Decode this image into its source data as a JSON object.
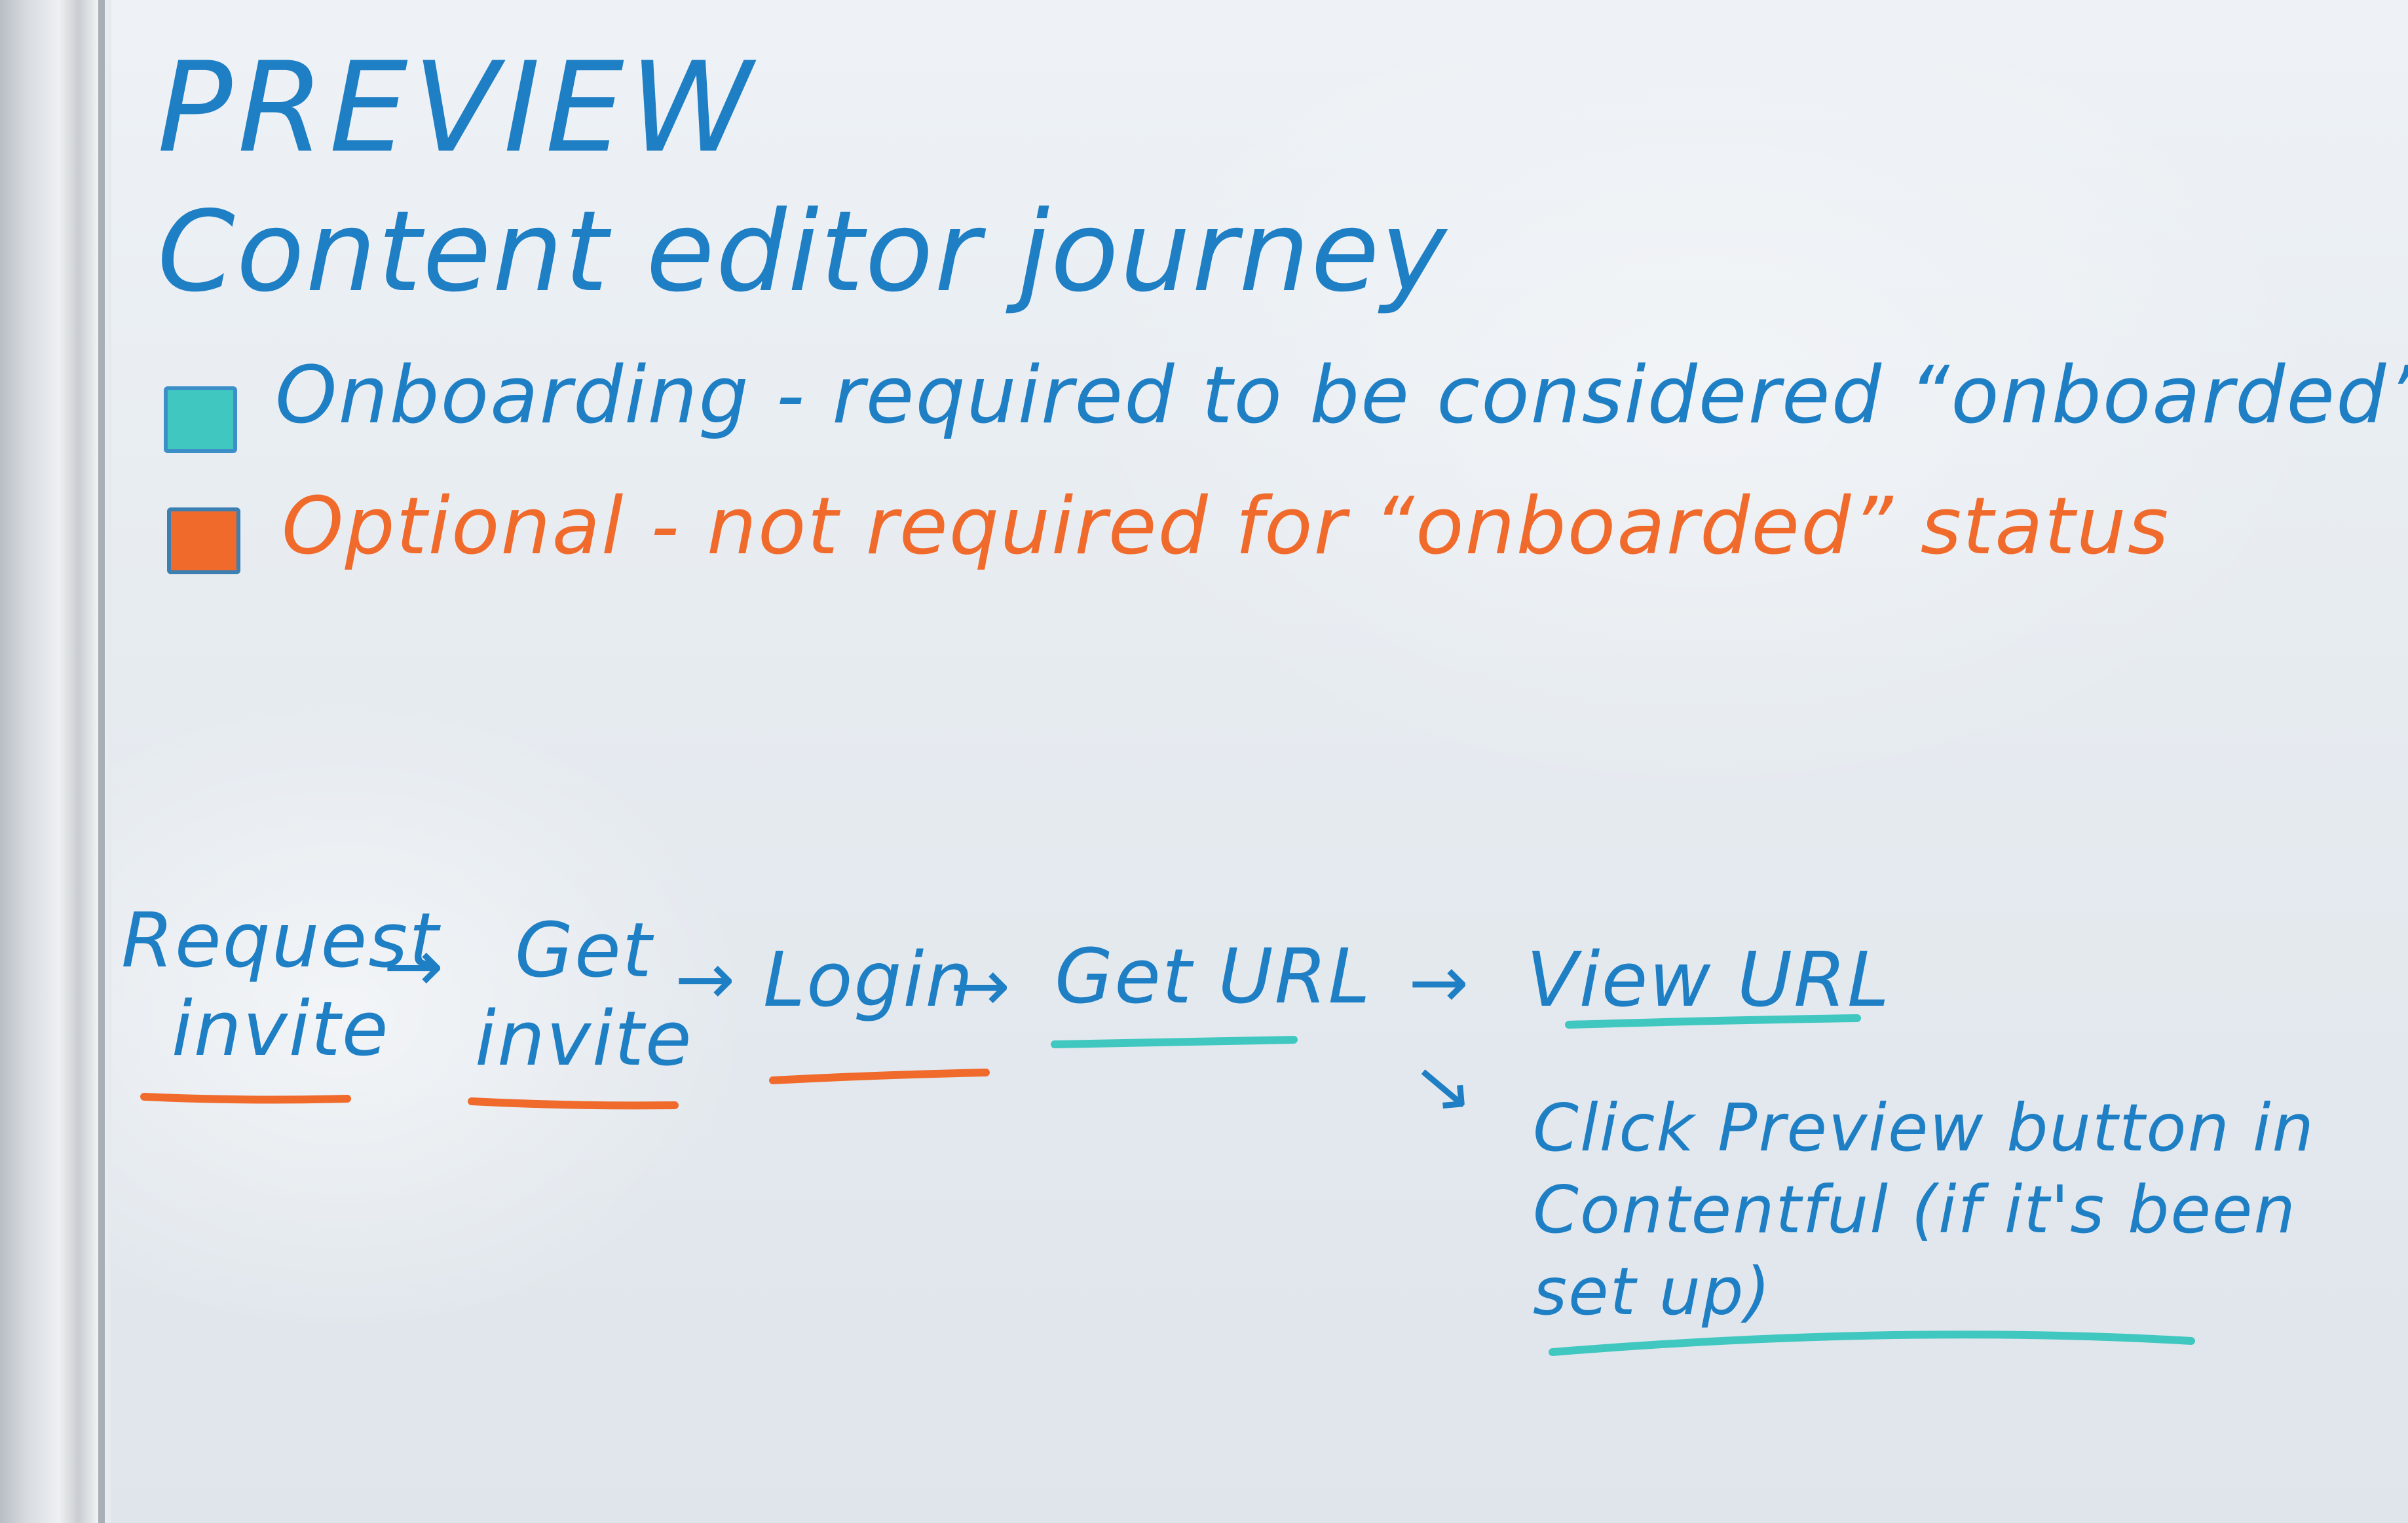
{
  "whiteboard": {
    "title": "PREVIEW",
    "subtitle": "Content editor journey",
    "legend": [
      {
        "text": "Onboarding - required to be considered “onboarded”",
        "color": "#40c8c0"
      },
      {
        "text": "Optional - not required for “onboarded” status",
        "color": "#f06a2c"
      }
    ],
    "flow": [
      {
        "line1": "Request",
        "line2": "invite",
        "underline": "orange"
      },
      {
        "line1": "Get",
        "line2": "invite",
        "underline": "orange"
      },
      {
        "line1": "Login",
        "line2": "",
        "underline": "orange"
      },
      {
        "line1": "Get URL",
        "line2": "",
        "underline": "teal"
      },
      {
        "line1": "View URL",
        "line2": "",
        "underline": "teal"
      }
    ],
    "branch_note": "Click Preview button in Contentful (if it's been set up)",
    "arrow_glyph": "→",
    "colors": {
      "marker_blue": "#1f7fc4",
      "marker_orange": "#f06a2c",
      "marker_teal": "#40c8c0",
      "board": "#e9edf1"
    }
  }
}
